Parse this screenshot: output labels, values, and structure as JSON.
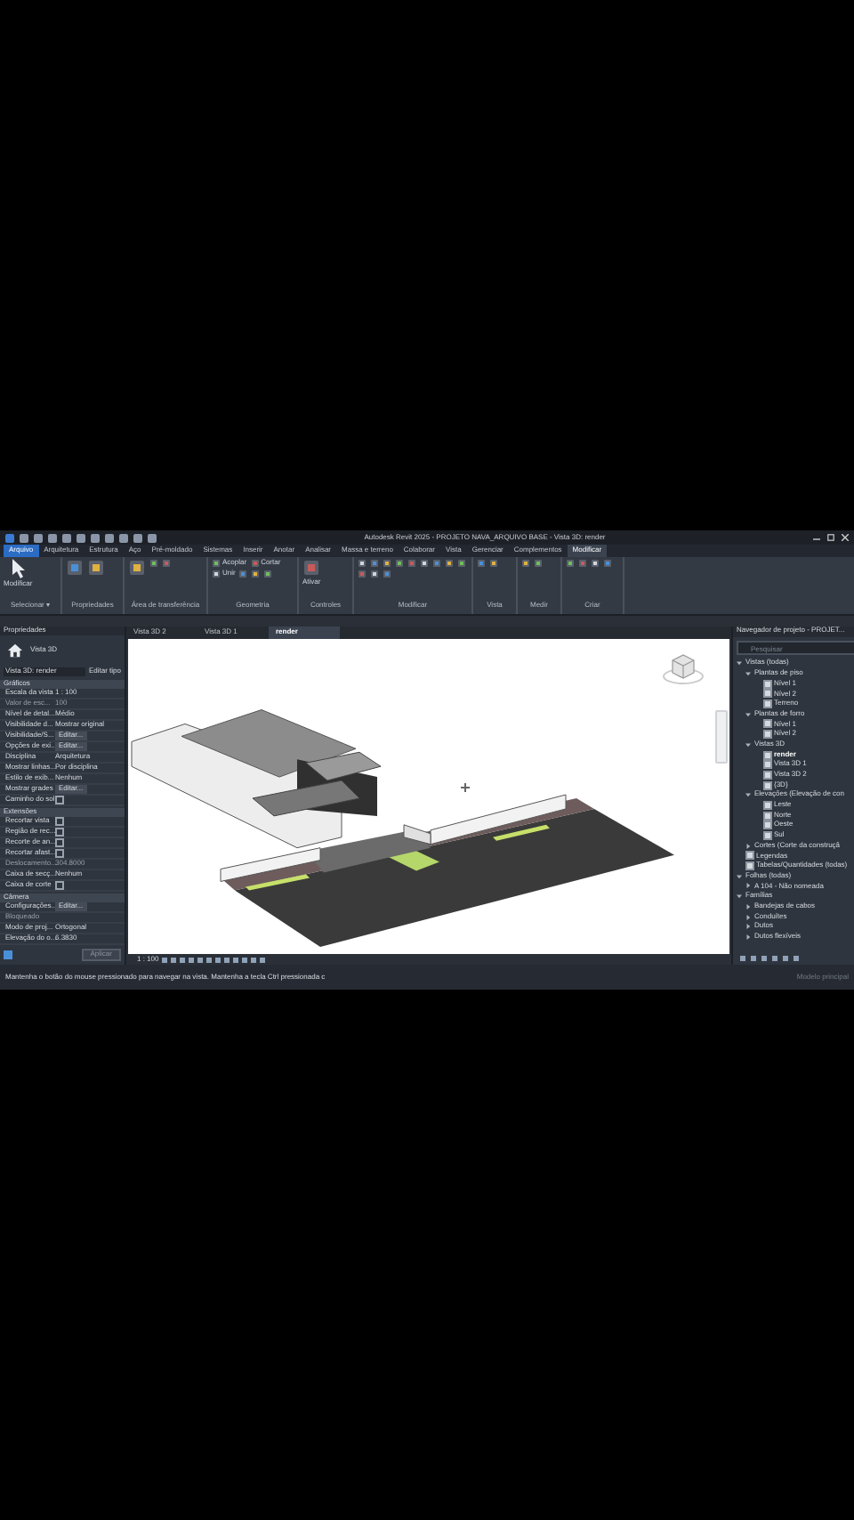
{
  "title_bar": {
    "title": "Autodesk Revit 2025 - PROJETO NAVA_ARQUIVO BASE - Vista 3D: render"
  },
  "ribbon_tabs": [
    {
      "label": "Arquivo",
      "selected": false,
      "kind": "file"
    },
    {
      "label": "Arquitetura",
      "selected": false,
      "kind": "tab"
    },
    {
      "label": "Estrutura",
      "selected": false,
      "kind": "tab"
    },
    {
      "label": "Aço",
      "selected": false,
      "kind": "tab"
    },
    {
      "label": "Pré-moldado",
      "selected": false,
      "kind": "tab"
    },
    {
      "label": "Sistemas",
      "selected": false,
      "kind": "tab"
    },
    {
      "label": "Inserir",
      "selected": false,
      "kind": "tab"
    },
    {
      "label": "Anotar",
      "selected": false,
      "kind": "tab"
    },
    {
      "label": "Analisar",
      "selected": false,
      "kind": "tab"
    },
    {
      "label": "Massa e terreno",
      "selected": false,
      "kind": "tab"
    },
    {
      "label": "Colaborar",
      "selected": false,
      "kind": "tab"
    },
    {
      "label": "Vista",
      "selected": false,
      "kind": "tab"
    },
    {
      "label": "Gerenciar",
      "selected": false,
      "kind": "tab"
    },
    {
      "label": "Complementos",
      "selected": false,
      "kind": "tab"
    },
    {
      "label": "Modificar",
      "selected": true,
      "kind": "tab"
    }
  ],
  "ribbon_panels": [
    {
      "label": "Selecionar ▾",
      "tools": [
        {
          "kind": "large",
          "label": "Modificar"
        }
      ]
    },
    {
      "label": "Propriedades",
      "tools": [
        {
          "kind": "large"
        },
        {
          "kind": "large"
        }
      ]
    },
    {
      "label": "Área de transferência",
      "tools": [
        {
          "kind": "large"
        },
        {
          "kind": "small"
        },
        {
          "kind": "small"
        }
      ]
    },
    {
      "label": "Geometria",
      "tools": [
        {
          "kind": "small",
          "label": "Acoplar"
        },
        {
          "kind": "small",
          "label": "Cortar"
        },
        {
          "kind": "small",
          "label": "Unir"
        },
        {
          "kind": "small"
        },
        {
          "kind": "small"
        },
        {
          "kind": "small"
        }
      ]
    },
    {
      "label": "Controles",
      "tools": [
        {
          "kind": "large",
          "label": "Ativar"
        }
      ]
    },
    {
      "label": "Modificar",
      "tools": [
        {
          "kind": "small"
        },
        {
          "kind": "small"
        },
        {
          "kind": "small"
        },
        {
          "kind": "small"
        },
        {
          "kind": "small"
        },
        {
          "kind": "small"
        },
        {
          "kind": "small"
        },
        {
          "kind": "small"
        },
        {
          "kind": "small"
        },
        {
          "kind": "small"
        },
        {
          "kind": "small"
        },
        {
          "kind": "small"
        }
      ]
    },
    {
      "label": "Vista",
      "tools": [
        {
          "kind": "small"
        },
        {
          "kind": "small"
        }
      ]
    },
    {
      "label": "Medir",
      "tools": [
        {
          "kind": "small"
        },
        {
          "kind": "small"
        }
      ]
    },
    {
      "label": "Criar",
      "tools": [
        {
          "kind": "small"
        },
        {
          "kind": "small"
        },
        {
          "kind": "small"
        },
        {
          "kind": "small"
        }
      ]
    }
  ],
  "properties": {
    "title": "Propriedades",
    "type_name": "Vista 3D",
    "type_selector": "Vista 3D: render",
    "edit_type": "Editar tipo",
    "groups": [
      {
        "name": "Gráficos",
        "rows": [
          {
            "label": "Escala da vista",
            "value": "1 : 100",
            "kind": "text"
          },
          {
            "label": "Valor de esc...",
            "value": "100",
            "kind": "readonly"
          },
          {
            "label": "Nível de detal...",
            "value": "Médio",
            "kind": "text"
          },
          {
            "label": "Visibilidade d...",
            "value": "Mostrar original",
            "kind": "text"
          },
          {
            "label": "Visibilidade/S...",
            "value": "Editar...",
            "kind": "button"
          },
          {
            "label": "Opções de exi...",
            "value": "Editar...",
            "kind": "button"
          },
          {
            "label": "Disciplina",
            "value": "Arquitetura",
            "kind": "text"
          },
          {
            "label": "Mostrar linhas...",
            "value": "Por disciplina",
            "kind": "text"
          },
          {
            "label": "Estilo de exib...",
            "value": "Nenhum",
            "kind": "text"
          },
          {
            "label": "Mostrar grades",
            "value": "Editar...",
            "kind": "button"
          },
          {
            "label": "Caminho do sol",
            "kind": "check",
            "checked": false
          }
        ]
      },
      {
        "name": "Extensões",
        "rows": [
          {
            "label": "Recortar vista",
            "kind": "check",
            "checked": false
          },
          {
            "label": "Região de rec...",
            "kind": "check",
            "checked": false
          },
          {
            "label": "Recorte de an...",
            "kind": "check",
            "checked": false
          },
          {
            "label": "Recortar afast...",
            "kind": "check",
            "checked": false
          },
          {
            "label": "Deslocamento...",
            "value": "304.8000",
            "kind": "readonly"
          },
          {
            "label": "Caixa de secç...",
            "value": "Nenhum",
            "kind": "text"
          },
          {
            "label": "Caixa de corte",
            "kind": "check",
            "checked": false
          }
        ]
      },
      {
        "name": "Câmera",
        "rows": [
          {
            "label": "Configurações...",
            "value": "Editar...",
            "kind": "button"
          },
          {
            "label": "Bloqueado",
            "kind": "readonly"
          },
          {
            "label": "Modo de proj...",
            "value": "Ortogonal",
            "kind": "text"
          },
          {
            "label": "Elevação do o...",
            "value": "6.3830",
            "kind": "text"
          }
        ]
      }
    ],
    "apply": "Aplicar"
  },
  "view_tabs": [
    {
      "label": "Vista 3D 2",
      "selected": false
    },
    {
      "label": "Vista 3D 1",
      "selected": false
    },
    {
      "label": "render",
      "selected": true
    }
  ],
  "view_control_bar": {
    "scale": "1 : 100"
  },
  "project_browser": {
    "title": "Navegador de projeto - PROJET...",
    "placeholder": "Pesquisar",
    "tree": [
      {
        "label": "Vistas (todas)",
        "expanded": true,
        "selected": false,
        "children": [
          {
            "label": "Plantas de piso",
            "expanded": true,
            "selected": false,
            "children": [
              {
                "label": "Nível 1",
                "selected": false
              },
              {
                "label": "Nível 2",
                "selected": false
              },
              {
                "label": "Terreno",
                "selected": false
              }
            ]
          },
          {
            "label": "Plantas de forro",
            "expanded": true,
            "selected": false,
            "children": [
              {
                "label": "Nível 1",
                "selected": false
              },
              {
                "label": "Nível 2",
                "selected": false
              }
            ]
          },
          {
            "label": "Vistas 3D",
            "expanded": true,
            "selected": false,
            "children": [
              {
                "label": "render",
                "selected": true
              },
              {
                "label": "Vista 3D 1",
                "selected": false
              },
              {
                "label": "Vista 3D 2",
                "selected": false
              },
              {
                "label": "{3D}",
                "selected": false
              }
            ]
          },
          {
            "label": "Elevações (Elevação de con",
            "expanded": true,
            "selected": false,
            "children": [
              {
                "label": "Leste",
                "selected": false
              },
              {
                "label": "Norte",
                "selected": false
              },
              {
                "label": "Oeste",
                "selected": false
              },
              {
                "label": "Sul",
                "selected": false
              }
            ]
          },
          {
            "label": "Cortes (Corte da construçã",
            "expanded": false,
            "selected": false
          }
        ]
      },
      {
        "label": "Legendas",
        "selected": false
      },
      {
        "label": "Tabelas/Quantidades (todas)",
        "selected": false
      },
      {
        "label": "Folhas (todas)",
        "expanded": true,
        "selected": false,
        "children": [
          {
            "label": "A 104 - Não nomeada",
            "expanded": false,
            "selected": false
          }
        ]
      },
      {
        "label": "Famílias",
        "expanded": true,
        "selected": false,
        "children": [
          {
            "label": "Bandejas de cabos",
            "expanded": false,
            "selected": false
          },
          {
            "label": "Conduítes",
            "expanded": false,
            "selected": false
          },
          {
            "label": "Dutos",
            "expanded": false,
            "selected": false
          },
          {
            "label": "Dutos flexíveis",
            "expanded": false,
            "selected": false
          }
        ]
      }
    ]
  },
  "status_bar": {
    "message": "Mantenha o botão do mouse pressionado para navegar na vista. Mantenha a tecla Ctrl pressionada c",
    "model": "Modelo principal"
  }
}
